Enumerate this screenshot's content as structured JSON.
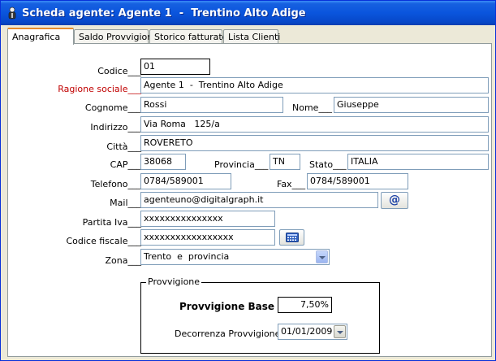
{
  "window": {
    "title": "Scheda agente: Agente 1  -  Trentino Alto Adige",
    "icon": "agent-icon"
  },
  "tabs": [
    {
      "label": "Anagrafica",
      "active": true
    },
    {
      "label": "Saldo Provvigioni",
      "active": false
    },
    {
      "label": "Storico fatturato",
      "active": false
    },
    {
      "label": "Lista Clienti",
      "active": false
    }
  ],
  "form": {
    "codice": {
      "label": "Codice___",
      "value": "01"
    },
    "ragione_sociale": {
      "label": "Ragione sociale___",
      "value": "Agente 1  -  Trentino Alto Adige",
      "color": "#c00000"
    },
    "cognome": {
      "label": "Cognome___",
      "value": "Rossi"
    },
    "nome": {
      "label": "Nome___",
      "value": "Giuseppe"
    },
    "indirizzo": {
      "label": "Indirizzo___",
      "value": "Via Roma   125/a"
    },
    "citta": {
      "label": "Città___",
      "value": "ROVERETO"
    },
    "cap": {
      "label": "CAP___",
      "value": "38068"
    },
    "provincia": {
      "label": "Provincia___",
      "value": "TN"
    },
    "stato": {
      "label": "Stato___",
      "value": "ITALIA"
    },
    "telefono": {
      "label": "Telefono___",
      "value": "0784/589001"
    },
    "fax": {
      "label": "Fax___",
      "value": "0784/589001"
    },
    "mail": {
      "label": "Mail___",
      "value": "agenteuno@digitalgraph.it",
      "button_icon": "at-icon"
    },
    "partita_iva": {
      "label": "Partita Iva___",
      "value": "xxxxxxxxxxxxxxx"
    },
    "codice_fiscale": {
      "label": "Codice fiscale___",
      "value": "xxxxxxxxxxxxxxxxx",
      "button_icon": "calculator-icon"
    },
    "zona": {
      "label": "Zona___",
      "value": "Trento  e  provincia"
    }
  },
  "provvigioni": {
    "legend": "Provvigione",
    "base_label": "Provvigione Base %",
    "base_value": "7,50%",
    "decorrenza_label": "Decorrenza Provvigione",
    "decorrenza_value": "01/01/2009"
  }
}
